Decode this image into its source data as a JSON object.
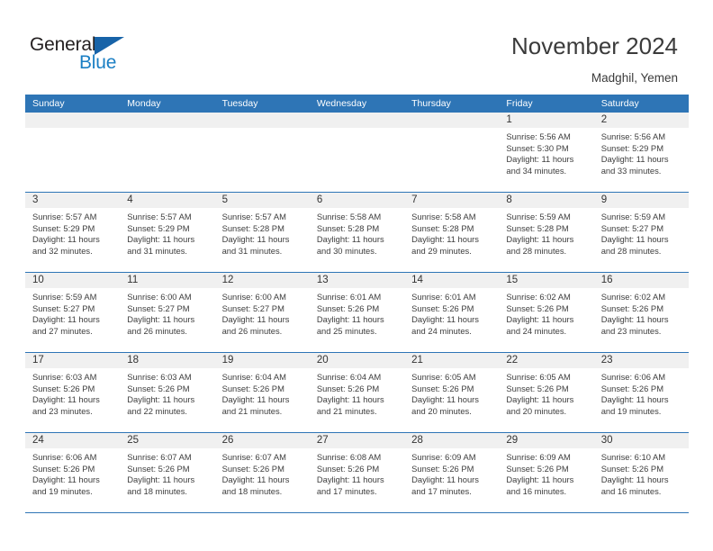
{
  "brand": {
    "name_part1": "General",
    "name_part2": "Blue"
  },
  "header": {
    "title": "November 2024",
    "location": "Madghil, Yemen"
  },
  "theme": {
    "header_blue": "#2e75b6",
    "band_gray": "#f0f0f0",
    "brand_blue": "#1b7fc4",
    "text_dark": "#3b3b3b"
  },
  "weekdays": [
    "Sunday",
    "Monday",
    "Tuesday",
    "Wednesday",
    "Thursday",
    "Friday",
    "Saturday"
  ],
  "weeks": [
    [
      {
        "day": "",
        "sunrise": "",
        "sunset": "",
        "daylight": ""
      },
      {
        "day": "",
        "sunrise": "",
        "sunset": "",
        "daylight": ""
      },
      {
        "day": "",
        "sunrise": "",
        "sunset": "",
        "daylight": ""
      },
      {
        "day": "",
        "sunrise": "",
        "sunset": "",
        "daylight": ""
      },
      {
        "day": "",
        "sunrise": "",
        "sunset": "",
        "daylight": ""
      },
      {
        "day": "1",
        "sunrise": "Sunrise: 5:56 AM",
        "sunset": "Sunset: 5:30 PM",
        "daylight": "Daylight: 11 hours and 34 minutes."
      },
      {
        "day": "2",
        "sunrise": "Sunrise: 5:56 AM",
        "sunset": "Sunset: 5:29 PM",
        "daylight": "Daylight: 11 hours and 33 minutes."
      }
    ],
    [
      {
        "day": "3",
        "sunrise": "Sunrise: 5:57 AM",
        "sunset": "Sunset: 5:29 PM",
        "daylight": "Daylight: 11 hours and 32 minutes."
      },
      {
        "day": "4",
        "sunrise": "Sunrise: 5:57 AM",
        "sunset": "Sunset: 5:29 PM",
        "daylight": "Daylight: 11 hours and 31 minutes."
      },
      {
        "day": "5",
        "sunrise": "Sunrise: 5:57 AM",
        "sunset": "Sunset: 5:28 PM",
        "daylight": "Daylight: 11 hours and 31 minutes."
      },
      {
        "day": "6",
        "sunrise": "Sunrise: 5:58 AM",
        "sunset": "Sunset: 5:28 PM",
        "daylight": "Daylight: 11 hours and 30 minutes."
      },
      {
        "day": "7",
        "sunrise": "Sunrise: 5:58 AM",
        "sunset": "Sunset: 5:28 PM",
        "daylight": "Daylight: 11 hours and 29 minutes."
      },
      {
        "day": "8",
        "sunrise": "Sunrise: 5:59 AM",
        "sunset": "Sunset: 5:28 PM",
        "daylight": "Daylight: 11 hours and 28 minutes."
      },
      {
        "day": "9",
        "sunrise": "Sunrise: 5:59 AM",
        "sunset": "Sunset: 5:27 PM",
        "daylight": "Daylight: 11 hours and 28 minutes."
      }
    ],
    [
      {
        "day": "10",
        "sunrise": "Sunrise: 5:59 AM",
        "sunset": "Sunset: 5:27 PM",
        "daylight": "Daylight: 11 hours and 27 minutes."
      },
      {
        "day": "11",
        "sunrise": "Sunrise: 6:00 AM",
        "sunset": "Sunset: 5:27 PM",
        "daylight": "Daylight: 11 hours and 26 minutes."
      },
      {
        "day": "12",
        "sunrise": "Sunrise: 6:00 AM",
        "sunset": "Sunset: 5:27 PM",
        "daylight": "Daylight: 11 hours and 26 minutes."
      },
      {
        "day": "13",
        "sunrise": "Sunrise: 6:01 AM",
        "sunset": "Sunset: 5:26 PM",
        "daylight": "Daylight: 11 hours and 25 minutes."
      },
      {
        "day": "14",
        "sunrise": "Sunrise: 6:01 AM",
        "sunset": "Sunset: 5:26 PM",
        "daylight": "Daylight: 11 hours and 24 minutes."
      },
      {
        "day": "15",
        "sunrise": "Sunrise: 6:02 AM",
        "sunset": "Sunset: 5:26 PM",
        "daylight": "Daylight: 11 hours and 24 minutes."
      },
      {
        "day": "16",
        "sunrise": "Sunrise: 6:02 AM",
        "sunset": "Sunset: 5:26 PM",
        "daylight": "Daylight: 11 hours and 23 minutes."
      }
    ],
    [
      {
        "day": "17",
        "sunrise": "Sunrise: 6:03 AM",
        "sunset": "Sunset: 5:26 PM",
        "daylight": "Daylight: 11 hours and 23 minutes."
      },
      {
        "day": "18",
        "sunrise": "Sunrise: 6:03 AM",
        "sunset": "Sunset: 5:26 PM",
        "daylight": "Daylight: 11 hours and 22 minutes."
      },
      {
        "day": "19",
        "sunrise": "Sunrise: 6:04 AM",
        "sunset": "Sunset: 5:26 PM",
        "daylight": "Daylight: 11 hours and 21 minutes."
      },
      {
        "day": "20",
        "sunrise": "Sunrise: 6:04 AM",
        "sunset": "Sunset: 5:26 PM",
        "daylight": "Daylight: 11 hours and 21 minutes."
      },
      {
        "day": "21",
        "sunrise": "Sunrise: 6:05 AM",
        "sunset": "Sunset: 5:26 PM",
        "daylight": "Daylight: 11 hours and 20 minutes."
      },
      {
        "day": "22",
        "sunrise": "Sunrise: 6:05 AM",
        "sunset": "Sunset: 5:26 PM",
        "daylight": "Daylight: 11 hours and 20 minutes."
      },
      {
        "day": "23",
        "sunrise": "Sunrise: 6:06 AM",
        "sunset": "Sunset: 5:26 PM",
        "daylight": "Daylight: 11 hours and 19 minutes."
      }
    ],
    [
      {
        "day": "24",
        "sunrise": "Sunrise: 6:06 AM",
        "sunset": "Sunset: 5:26 PM",
        "daylight": "Daylight: 11 hours and 19 minutes."
      },
      {
        "day": "25",
        "sunrise": "Sunrise: 6:07 AM",
        "sunset": "Sunset: 5:26 PM",
        "daylight": "Daylight: 11 hours and 18 minutes."
      },
      {
        "day": "26",
        "sunrise": "Sunrise: 6:07 AM",
        "sunset": "Sunset: 5:26 PM",
        "daylight": "Daylight: 11 hours and 18 minutes."
      },
      {
        "day": "27",
        "sunrise": "Sunrise: 6:08 AM",
        "sunset": "Sunset: 5:26 PM",
        "daylight": "Daylight: 11 hours and 17 minutes."
      },
      {
        "day": "28",
        "sunrise": "Sunrise: 6:09 AM",
        "sunset": "Sunset: 5:26 PM",
        "daylight": "Daylight: 11 hours and 17 minutes."
      },
      {
        "day": "29",
        "sunrise": "Sunrise: 6:09 AM",
        "sunset": "Sunset: 5:26 PM",
        "daylight": "Daylight: 11 hours and 16 minutes."
      },
      {
        "day": "30",
        "sunrise": "Sunrise: 6:10 AM",
        "sunset": "Sunset: 5:26 PM",
        "daylight": "Daylight: 11 hours and 16 minutes."
      }
    ]
  ]
}
